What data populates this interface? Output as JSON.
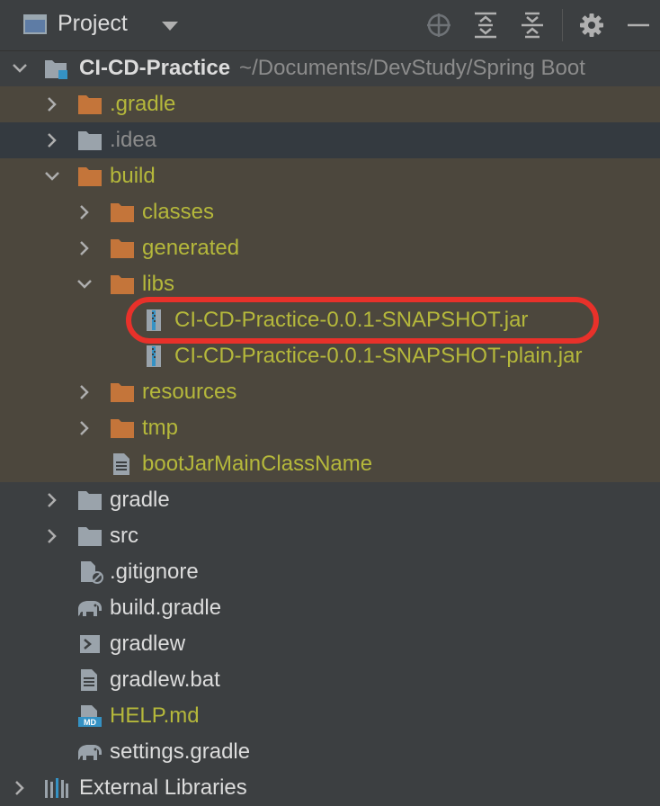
{
  "toolbar": {
    "title": "Project",
    "icons": [
      "project-window-icon",
      "dropdown-caret-icon",
      "locate-icon",
      "expand-all-icon",
      "collapse-all-icon",
      "settings-gear-icon",
      "minimize-icon"
    ]
  },
  "root": {
    "name": "CI-CD-Practice",
    "path": "~/Documents/DevStudy/Spring Boot"
  },
  "items": [
    {
      "label": ".gradle"
    },
    {
      "label": ".idea"
    },
    {
      "label": "build"
    },
    {
      "label": "classes"
    },
    {
      "label": "generated"
    },
    {
      "label": "libs"
    },
    {
      "label": "CI-CD-Practice-0.0.1-SNAPSHOT.jar"
    },
    {
      "label": "CI-CD-Practice-0.0.1-SNAPSHOT-plain.jar"
    },
    {
      "label": "resources"
    },
    {
      "label": "tmp"
    },
    {
      "label": "bootJarMainClassName"
    },
    {
      "label": "gradle"
    },
    {
      "label": "src"
    },
    {
      "label": ".gitignore"
    },
    {
      "label": "build.gradle"
    },
    {
      "label": "gradlew"
    },
    {
      "label": "gradlew.bat"
    },
    {
      "label": "HELP.md"
    },
    {
      "label": "settings.gradle"
    },
    {
      "label": "External Libraries"
    }
  ],
  "colors": {
    "background": "#3c3f41",
    "excluded_row": "#4c473d",
    "selected_row": "#343a40",
    "folder_orange": "#c4753a",
    "folder_gray": "#9aa3ab",
    "excluded_text": "#b5b83b",
    "highlight_ring": "#e8312a"
  }
}
